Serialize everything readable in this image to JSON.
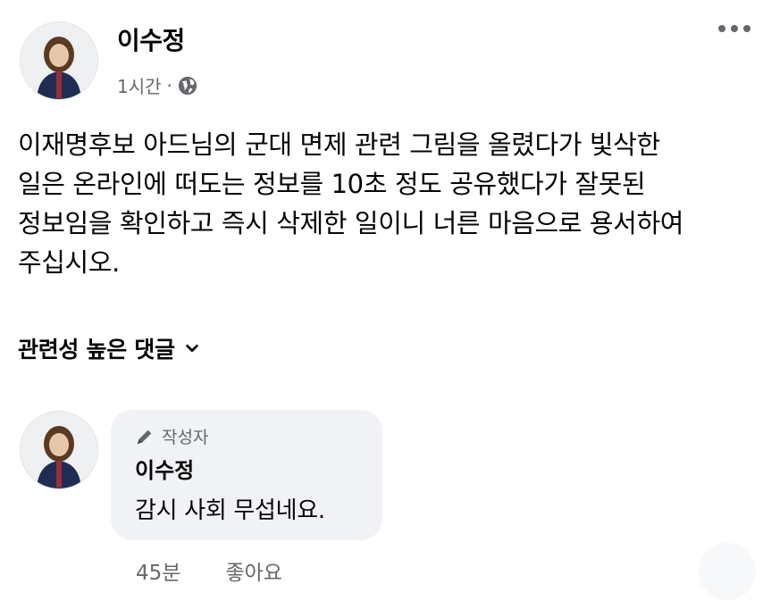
{
  "post": {
    "author": "이수정",
    "time": "1시간",
    "separator": "·",
    "privacy_icon": "globe-icon",
    "text": "이재명후보 아드님의 군대 면제 관련 그림을 올렸다가 빛삭한\n일은 온라인에 떠도는 정보를 10초 정도 공유했다가 잘못된\n정보임을 확인하고 즉시 삭제한 일이니 너른 마음으로 용서하여\n주십시오."
  },
  "comments_filter": {
    "label": "관련성 높은 댓글"
  },
  "comment": {
    "badge": "작성자",
    "author": "이수정",
    "text": "감시 사회 무섭네요.",
    "time": "45분",
    "like_label": "좋아요"
  },
  "colors": {
    "text_primary": "#050505",
    "text_secondary": "#65676b",
    "bubble_bg": "#f0f2f5"
  }
}
